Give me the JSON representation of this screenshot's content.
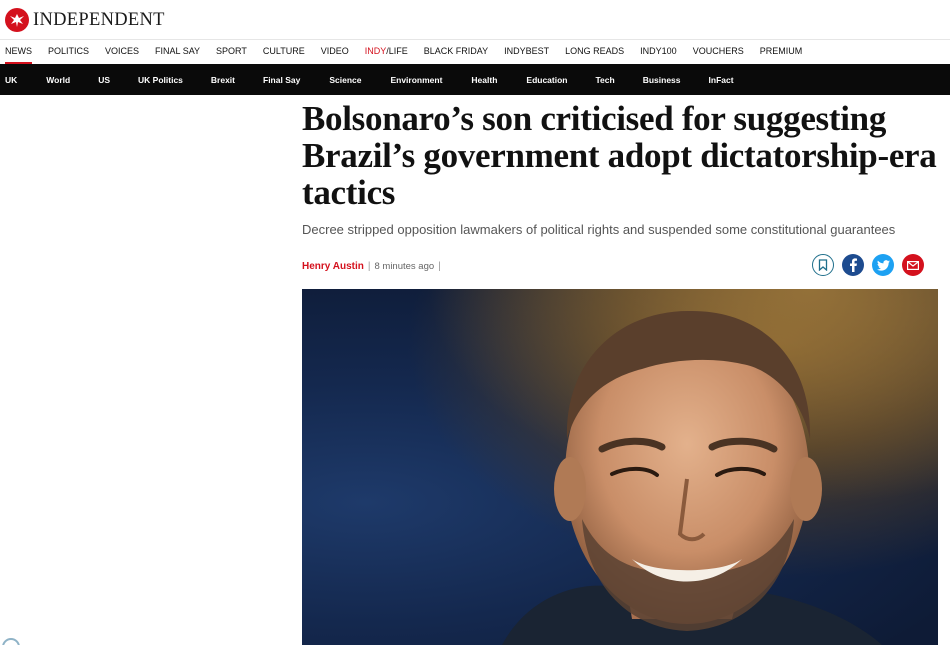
{
  "brand": {
    "name": "INDEPENDENT",
    "accent": "#d4111d"
  },
  "primary_nav": [
    {
      "label": "NEWS",
      "active": true
    },
    {
      "label": "POLITICS"
    },
    {
      "label": "VOICES"
    },
    {
      "label": "FINAL SAY"
    },
    {
      "label": "SPORT"
    },
    {
      "label": "CULTURE"
    },
    {
      "label": "VIDEO"
    },
    {
      "label_indy": "INDY",
      "label_life": "/LIFE"
    },
    {
      "label": "BLACK FRIDAY"
    },
    {
      "label": "INDYBEST"
    },
    {
      "label": "LONG READS"
    },
    {
      "label": "INDY100"
    },
    {
      "label": "VOUCHERS"
    },
    {
      "label": "PREMIUM"
    }
  ],
  "secondary_nav": [
    {
      "label": "UK"
    },
    {
      "label": "World"
    },
    {
      "label": "US"
    },
    {
      "label": "UK Politics"
    },
    {
      "label": "Brexit"
    },
    {
      "label": "Final Say"
    },
    {
      "label": "Science"
    },
    {
      "label": "Environment"
    },
    {
      "label": "Health"
    },
    {
      "label": "Education"
    },
    {
      "label": "Tech"
    },
    {
      "label": "Business"
    },
    {
      "label": "InFact"
    }
  ],
  "article": {
    "headline": "Bolsonaro’s son criticised for suggesting Brazil’s government adopt dictatorship-era tactics",
    "standfirst": "Decree stripped opposition lawmakers of political rights and suspended some constitutional guarantees",
    "author": "Henry Austin",
    "separator": "|",
    "time": "8 minutes ago"
  },
  "share_icons": [
    "bookmark-icon",
    "facebook-icon",
    "twitter-icon",
    "email-icon"
  ]
}
